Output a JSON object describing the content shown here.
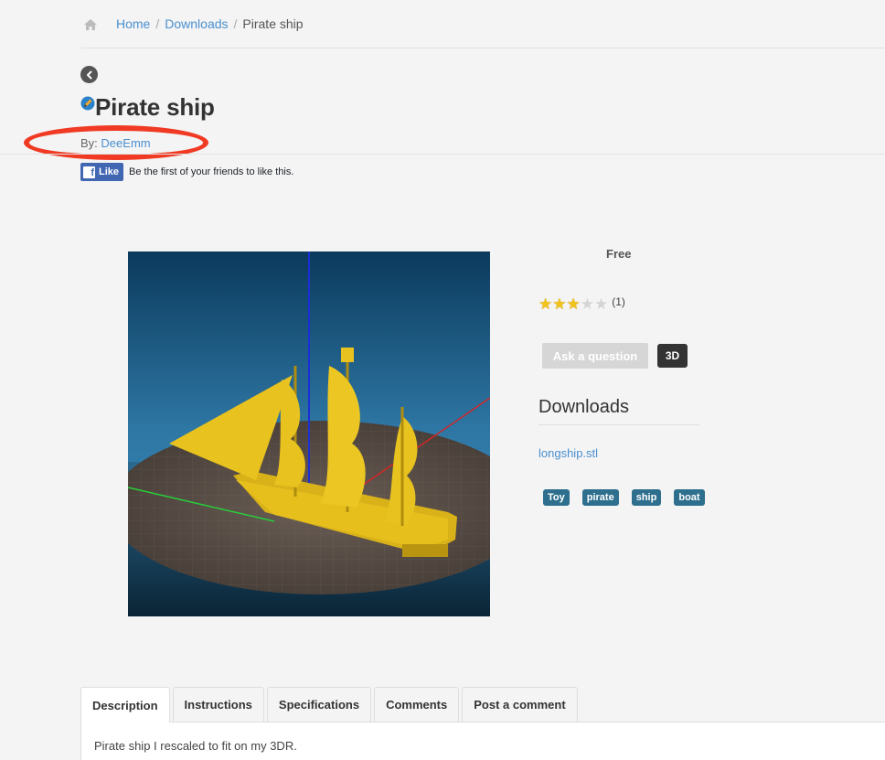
{
  "breadcrumb": {
    "home_icon": "home-icon",
    "items": [
      {
        "label": "Home"
      },
      {
        "label": "Downloads"
      }
    ],
    "current": "Pirate ship",
    "separator": "/"
  },
  "back_icon": "chevron-left-circle-icon",
  "title": "Pirate ship",
  "byline": {
    "prefix": "By:",
    "author": "DeeEmm",
    "highlight_color": "#f03a23"
  },
  "facebook": {
    "like_label": "Like",
    "text": "Be the first of your friends to like this."
  },
  "preview": {
    "alt": "3D render of pirate ship model",
    "background_top": "#0b3a5c",
    "background_bottom": "#2f78a6",
    "model_color": "#e8c21e"
  },
  "sidebar": {
    "price": "Free",
    "rating": {
      "stars_filled": 3,
      "stars_total": 5,
      "count": "(1)"
    },
    "ask_button": "Ask a question",
    "view3d_button": "3D",
    "downloads_heading": "Downloads",
    "file": "longship.stl",
    "tags": [
      "Toy",
      "pirate",
      "ship",
      "boat"
    ]
  },
  "tabs": [
    {
      "label": "Description",
      "active": true
    },
    {
      "label": "Instructions",
      "active": false
    },
    {
      "label": "Specifications",
      "active": false
    },
    {
      "label": "Comments",
      "active": false
    },
    {
      "label": "Post a comment",
      "active": false
    }
  ],
  "description": "Pirate ship I rescaled to fit on my 3DR."
}
